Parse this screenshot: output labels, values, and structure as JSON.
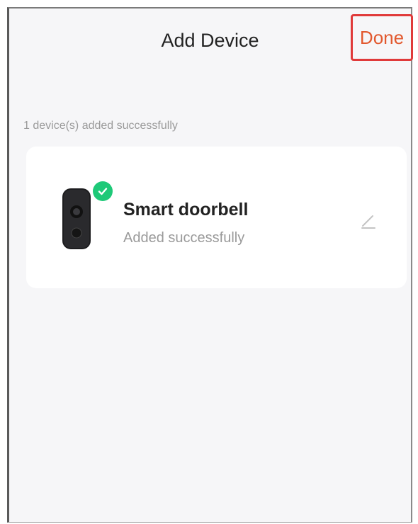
{
  "header": {
    "title": "Add Device",
    "done_label": "Done"
  },
  "status_text": "1 device(s) added successfully",
  "devices": [
    {
      "name": "Smart doorbell",
      "status": "Added successfully",
      "icon": "doorbell-icon",
      "badge_icon": "check-circle-icon"
    }
  ],
  "colors": {
    "accent": "#e2592f",
    "highlight_border": "#e03a3a",
    "success": "#1ec978"
  }
}
